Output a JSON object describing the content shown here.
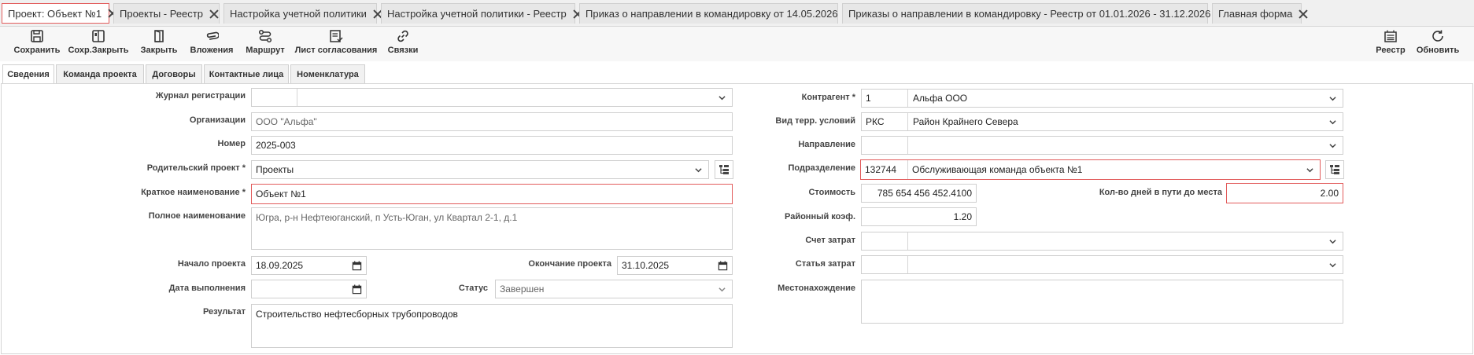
{
  "window_tabs": [
    {
      "label": "Проект: Объект №1",
      "active": true
    },
    {
      "label": "Проекты - Реестр"
    },
    {
      "label": "Настройка учетной политики"
    },
    {
      "label": "Настройка учетной политики - Реестр"
    },
    {
      "label": "Приказ о направлении в командировку от 14.05.2026"
    },
    {
      "label": "Приказы о направлении в командировку - Реестр от 01.01.2026 - 31.12.2026"
    },
    {
      "label": "Главная форма"
    }
  ],
  "toolbar": {
    "save": "Сохранить",
    "save_close": "Сохр.Закрыть",
    "close": "Закрыть",
    "attachments": "Вложения",
    "route": "Маршрут",
    "approval_sheet": "Лист согласования",
    "links": "Связки",
    "registry": "Реестр",
    "refresh": "Обновить"
  },
  "content_tabs": [
    "Сведения",
    "Команда проекта",
    "Договоры",
    "Контактные лица",
    "Номенклатура"
  ],
  "form": {
    "journal": {
      "label": "Журнал регистрации",
      "code": "",
      "value": ""
    },
    "organization": {
      "label": "Организации",
      "value": "ООО \"Альфа\""
    },
    "number": {
      "label": "Номер",
      "value": "2025-003"
    },
    "parent_project": {
      "label": "Родительский проект *",
      "value": "Проекты"
    },
    "short_name": {
      "label": "Краткое наименование *",
      "value": "Объект №1"
    },
    "full_name": {
      "label": "Полное наименование",
      "value": "Югра, р-н Нефтеюганский, п Усть-Юган, ул Квартал 2-1, д.1"
    },
    "start_date": {
      "label": "Начало проекта",
      "value": "18.09.2025"
    },
    "end_date": {
      "label": "Окончание проекта",
      "value": "31.10.2025"
    },
    "completion_date": {
      "label": "Дата выполнения",
      "value": ""
    },
    "status": {
      "label": "Статус",
      "value": "Завершен"
    },
    "result": {
      "label": "Результат",
      "value": "Строительство нефтесборных трубопроводов"
    },
    "counterparty": {
      "label": "Контрагент *",
      "code": "1",
      "value": "Альфа ООО"
    },
    "territory": {
      "label": "Вид терр. условий",
      "code": "РКС",
      "value": "Район Крайнего Севера"
    },
    "direction": {
      "label": "Направление",
      "code": "",
      "value": ""
    },
    "department": {
      "label": "Подразделение",
      "code": "132744",
      "value": "Обслуживающая команда объекта №1"
    },
    "cost": {
      "label": "Стоимость",
      "value": "785 654 456 452.4100"
    },
    "travel_days": {
      "label": "Кол-во дней в пути до места",
      "value": "2.00"
    },
    "district_coef": {
      "label": "Районный коэф.",
      "value": "1.20"
    },
    "cost_account": {
      "label": "Счет затрат",
      "code": "",
      "value": ""
    },
    "cost_item": {
      "label": "Статья затрат",
      "code": "",
      "value": ""
    },
    "location": {
      "label": "Местонахождение",
      "value": ""
    }
  },
  "colors": {
    "error_border": "#e25b5b",
    "border": "#cfcfcf",
    "tab_bg": "#e7e7e7"
  }
}
